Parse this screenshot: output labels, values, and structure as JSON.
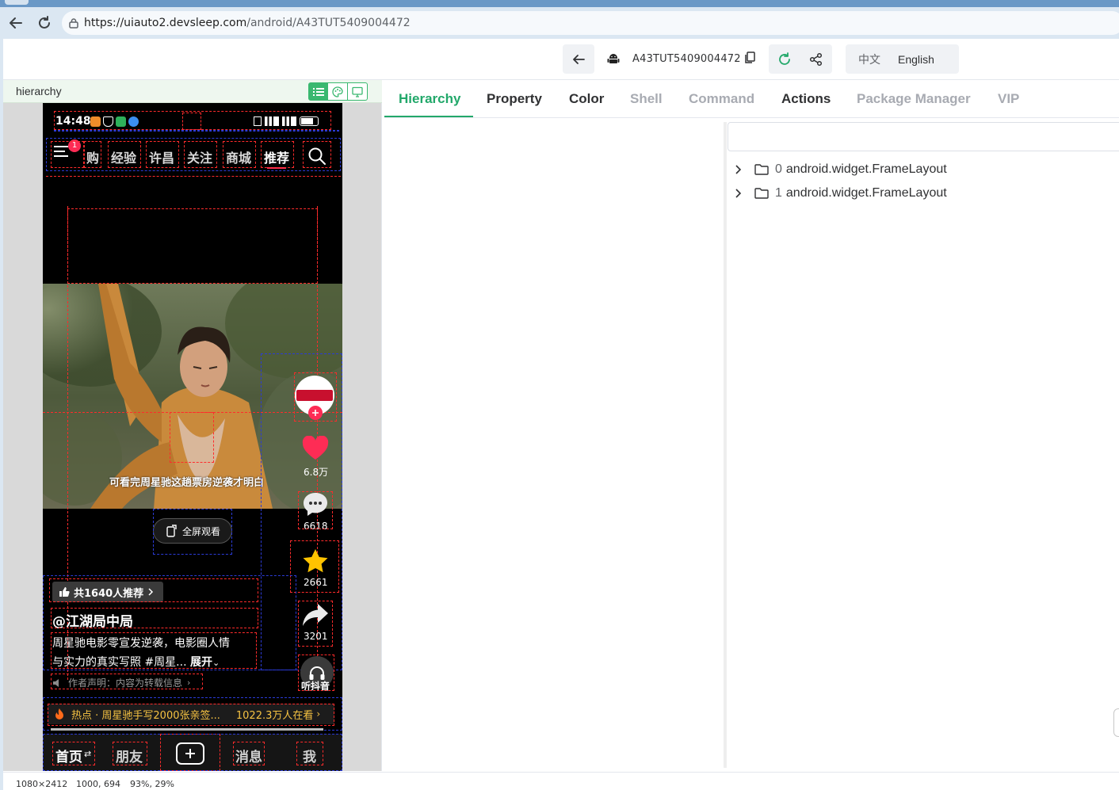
{
  "browser": {
    "url_host": "https://uiauto2.devsleep.com",
    "url_path": "/android/A43TUT5409004472"
  },
  "header": {
    "serial": "A43TUT5409004472",
    "lang_zh": "中文",
    "lang_en": "English"
  },
  "left_panel": {
    "title": "hierarchy"
  },
  "phone": {
    "status_time": "14:48",
    "nav_tabs": [
      "购",
      "经验",
      "许昌",
      "关注",
      "商城",
      "推荐"
    ],
    "menu_badge": "1",
    "subtitle": "可看完周星驰这趟票房逆袭才明白",
    "fullscreen_label": "全屏观看",
    "likes": "6.8万",
    "comments": "6618",
    "favorites": "2661",
    "shares": "3201",
    "listen_label": "听抖音",
    "recommend_label": "共1640人推荐",
    "author": "@江湖局中局",
    "desc_line1": "周星驰电影零宣发逆袭，电影圈人情",
    "desc_line2": "与实力的真实写照 #周星...",
    "expand_label": "展开",
    "notice": "作者声明：内容为转载信息",
    "hot_prefix": "热点 · 周星驰手写2000张亲签...",
    "hot_viewers": "1022.3万人在看",
    "bottom_nav": [
      "首页",
      "朋友",
      "",
      "消息",
      "我"
    ]
  },
  "tabs": [
    {
      "label": "Hierarchy",
      "state": "active"
    },
    {
      "label": "Property",
      "state": "normal"
    },
    {
      "label": "Color",
      "state": "normal"
    },
    {
      "label": "Shell",
      "state": "dim"
    },
    {
      "label": "Command",
      "state": "dim"
    },
    {
      "label": "Actions",
      "state": "normal"
    },
    {
      "label": "Package Manager",
      "state": "dim"
    },
    {
      "label": "VIP",
      "state": "dim"
    }
  ],
  "tree": [
    {
      "index": "0",
      "label": "android.widget.FrameLayout"
    },
    {
      "index": "1",
      "label": "android.widget.FrameLayout"
    }
  ],
  "status": {
    "resolution": "1080×2412",
    "coords": "1000, 694",
    "percent": "93%, 29%"
  },
  "colors": {
    "accent": "#22a86a",
    "dim_tab": "#a8abb2"
  }
}
